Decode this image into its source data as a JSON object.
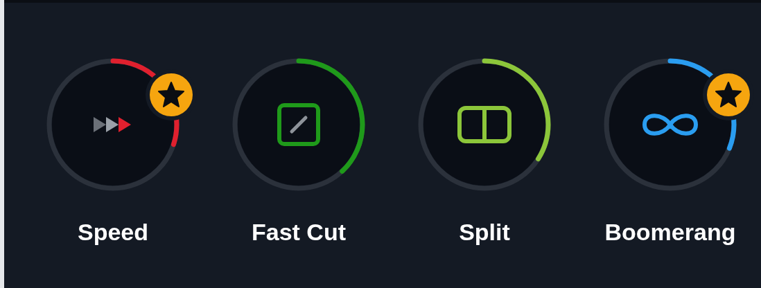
{
  "effects": [
    {
      "label": "Speed",
      "kind": "speed",
      "color": "#e0202e",
      "favorite": true
    },
    {
      "label": "Fast Cut",
      "kind": "fastcut",
      "color": "#1f9a1a",
      "favorite": false
    },
    {
      "label": "Split",
      "kind": "split",
      "color": "#8cc63a",
      "favorite": false
    },
    {
      "label": "Boomerang",
      "kind": "boomerang",
      "color": "#2a9df0",
      "favorite": true
    }
  ]
}
